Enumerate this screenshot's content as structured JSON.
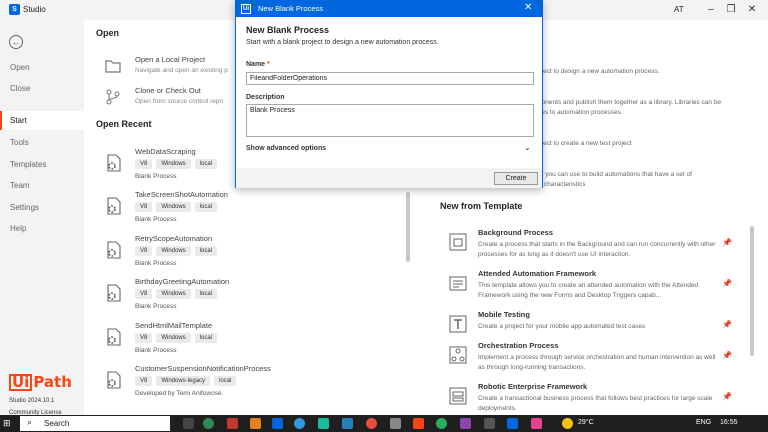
{
  "titlebar": {
    "app_title": "Studio",
    "user": "AT"
  },
  "nav": {
    "items": [
      {
        "label": "Open"
      },
      {
        "label": "Close"
      },
      {
        "label": "Start"
      },
      {
        "label": "Tools"
      },
      {
        "label": "Templates"
      },
      {
        "label": "Team"
      },
      {
        "label": "Settings"
      },
      {
        "label": "Help"
      }
    ],
    "brand": "Path",
    "brand_ui": "Ui",
    "version": "Studio 2024.10.1",
    "license": "Community License"
  },
  "open": {
    "title": "Open",
    "items": [
      {
        "title": "Open a Local Project",
        "desc": "Navigate and open an existing p"
      },
      {
        "title": "Clone or Check Out",
        "desc": "Open from source control repo"
      }
    ]
  },
  "recent": {
    "title": "Open Recent",
    "items": [
      {
        "name": "WebDataScraping",
        "tags": [
          "V8",
          "Windows",
          "local"
        ],
        "desc": "Blank Process"
      },
      {
        "name": "TakeScreenShotAutomation",
        "tags": [
          "V8",
          "Windows",
          "local"
        ],
        "desc": "Blank Process"
      },
      {
        "name": "RetryScopeAutomation",
        "tags": [
          "V8",
          "Windows",
          "local"
        ],
        "desc": "Blank Process"
      },
      {
        "name": "BirthdayGreetingAutomation",
        "tags": [
          "V8",
          "Windows",
          "local"
        ],
        "desc": "Blank Process"
      },
      {
        "name": "SendHtmlMailTemplate",
        "tags": [
          "V8",
          "Windows",
          "local"
        ],
        "desc": "Blank Process"
      },
      {
        "name": "CustomerSuspensionNotificationProcess",
        "tags": [
          "V8",
          "Windows-legacy",
          "local"
        ],
        "desc": "Developed by Temi Anifowose."
      }
    ]
  },
  "right_partial": {
    "line1": "oject to design a new automation process.",
    "line2a": "ponents and publish them together as a library. Libraries can be",
    "line2b": "ties to automation processes.",
    "line3": "oject to create a new test project",
    "line4a": "at you can use to build automations that have a set of",
    "line4b": "characteristics"
  },
  "templates": {
    "title": "New from Template",
    "items": [
      {
        "title": "Background Process",
        "desc": "Create a process that starts in the Background and can run concurrently with other processes for as long as it doesn't use UI interaction."
      },
      {
        "title": "Attended Automation Framework",
        "desc": "This template allows you to create an attended automation with the Attended Framework using the new Forms and Desktop Triggers capab..."
      },
      {
        "title": "Mobile Testing",
        "desc": "Create a project for your mobile app automated test cases"
      },
      {
        "title": "Orchestration Process",
        "desc": "Implement a process through service orchestration and human intervention as well as through long-running transactions."
      },
      {
        "title": "Robotic Enterprise Framework",
        "desc": "Create a transactional business process that follows best practices for large scale deployments."
      }
    ]
  },
  "dialog": {
    "title": "New Blank Process",
    "heading": "New Blank Process",
    "subtitle": "Start with a blank project to design a new automation process.",
    "name_label": "Name",
    "name_required": "*",
    "name_value": "FileandFolderOperations",
    "desc_label": "Description",
    "desc_value": "Blank Process",
    "advanced": "Show advanced options",
    "create": "Create"
  },
  "taskbar": {
    "search": "Search",
    "temp": "29°C",
    "lang": "ENG",
    "time": "16:55"
  },
  "colors": {
    "accent": "#0067df",
    "brand": "#fa4616"
  }
}
